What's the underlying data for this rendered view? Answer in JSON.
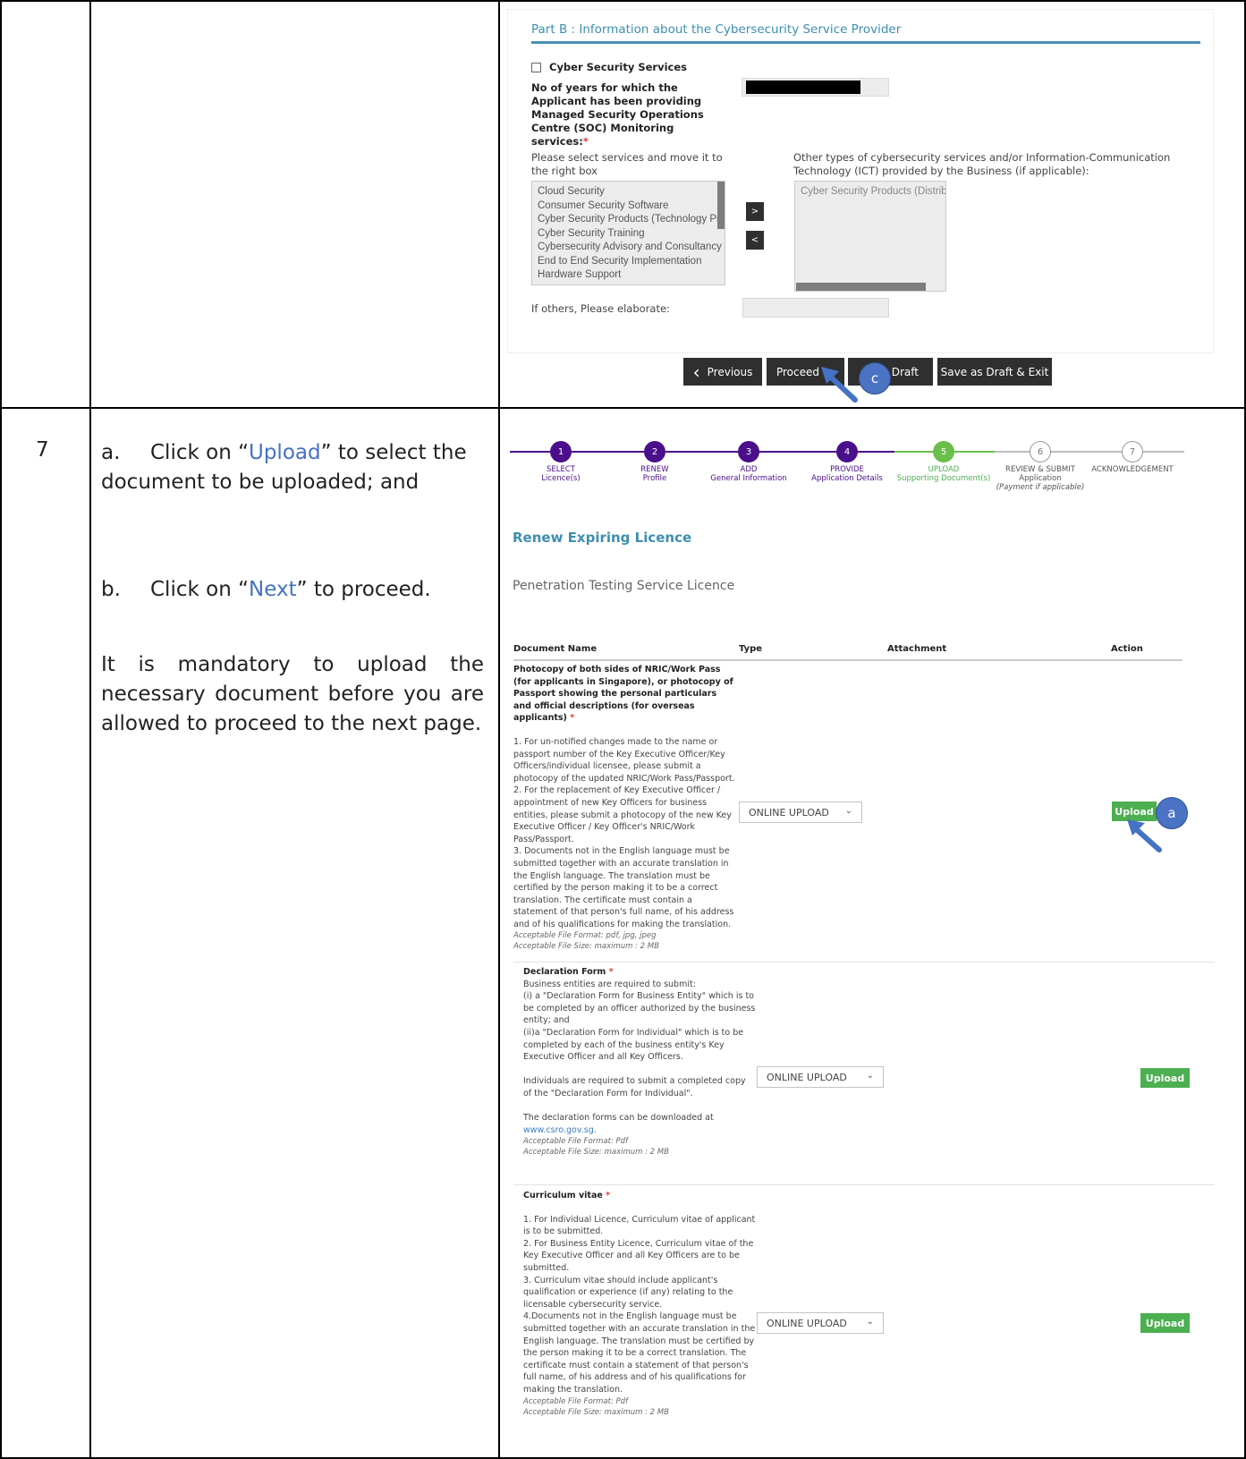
{
  "row7": {
    "number": "7",
    "instr_a_prefix": "a.",
    "instr_a_pre": "Click on “",
    "instr_a_link": "Upload",
    "instr_a_post": "” to select the document to be uploaded; and",
    "instr_b_prefix": "b.",
    "instr_b_pre": "Click on “",
    "instr_b_link": "Next",
    "instr_b_post": "” to proceed.",
    "instr_note": "It is mandatory to upload the necessary document before you are allowed to proceed to the next page."
  },
  "partb": {
    "title": "Part B : Information about the Cybersecurity Service Provider",
    "checkbox_label": "Cyber Security Services",
    "years_label": "No of years for which the Applicant has been providing Managed Security Operations Centre (SOC) Monitoring services:",
    "req_star": "*",
    "select_hint": "Please select services and move it to the right box",
    "other_types": "Other types of cybersecurity services and/or Information-Communication Technology (ICT) provided by the Business (if applicable):",
    "left_options": [
      "Cloud Security",
      "Consumer Security Software",
      "Cyber Security Products (Technology Pro",
      "Cyber Security Training",
      "Cybersecurity Advisory and Consultancy",
      "End to End Security Implementation",
      "Hardware Support"
    ],
    "right_options": [
      "Cyber Security Products (Distribu"
    ],
    "move_right": ">",
    "move_left": "<",
    "elaborate_label": "If others, Please elaborate:",
    "buttons": {
      "previous": "Previous",
      "proceed": "Proceed",
      "draft": "Draft",
      "save_exit": "Save as Draft & Exit"
    },
    "badge_c": "c"
  },
  "stepper": [
    {
      "num": "1",
      "line1": "SELECT",
      "line2": "Licence(s)",
      "line3": "",
      "state": "done"
    },
    {
      "num": "2",
      "line1": "RENEW",
      "line2": "Profile",
      "line3": "",
      "state": "done"
    },
    {
      "num": "3",
      "line1": "ADD",
      "line2": "General Information",
      "line3": "",
      "state": "done"
    },
    {
      "num": "4",
      "line1": "PROVIDE",
      "line2": "Application Details",
      "line3": "",
      "state": "done"
    },
    {
      "num": "5",
      "line1": "UPLOAD",
      "line2": "Supporting Document(s)",
      "line3": "",
      "state": "current"
    },
    {
      "num": "6",
      "line1": "REVIEW & SUBMIT",
      "line2": "Application",
      "line3": "(Payment if applicable)",
      "state": "todo"
    },
    {
      "num": "7",
      "line1": "ACKNOWLEDGEMENT",
      "line2": "",
      "line3": "",
      "state": "todo"
    }
  ],
  "upload_page": {
    "heading": "Renew Expiring Licence",
    "licence": "Penetration Testing Service Licence",
    "columns": {
      "name": "Document Name",
      "type": "Type",
      "attachment": "Attachment",
      "action": "Action"
    },
    "select_value": "ONLINE UPLOAD",
    "upload_label": "Upload",
    "badge_a": "a",
    "doc1": {
      "title": "Photocopy of both sides of NRIC/Work Pass (for applicants in Singapore), or photocopy of Passport showing the personal particulars and official descriptions (for overseas applicants)",
      "body": "1. For un-notified changes made to the name or passport number of the Key Executive Officer/Key Officers/individual licensee, please submit a photocopy of the updated NRIC/Work Pass/Passport.\n2. For the replacement of Key Executive Officer / appointment of new Key Officers for business entities, please submit a photocopy of the new Key Executive Officer / Key Officer's NRIC/Work Pass/Passport.\n3. Documents not in the English language must be submitted together with an accurate translation in the English language. The translation must be certified by the person making it to be a correct translation. The certificate must contain a statement of that person's full name, of his address and of his qualifications for making the translation.",
      "format": "Acceptable File Format: pdf, jpg, jpeg",
      "size": "Acceptable File Size: maximum : 2 MB"
    },
    "doc2": {
      "title": "Declaration Form",
      "body": "Business entities are required to submit:\n(i) a \"Declaration Form for Business Entity\" which is to be completed by an officer authorized by the business entity; and\n(ii)a \"Declaration Form for Individual\" which is to be completed by each of the business entity's Key Executive Officer and all Key Officers.\n\nIndividuals are required to submit a completed copy of the \"Declaration Form for Individual\".\n\nThe declaration forms can be downloaded at",
      "link": "www.csro.gov.sg.",
      "format": "Acceptable File Format: Pdf",
      "size": "Acceptable File Size: maximum : 2 MB"
    },
    "doc3": {
      "title": "Curriculum vitae",
      "body": "1. For Individual Licence, Curriculum vitae of applicant is to be submitted.\n2. For Business Entity Licence, Curriculum vitae of the Key Executive Officer and all Key Officers are to be submitted.\n3. Curriculum vitae should include applicant's qualification or experience (if any) relating to the licensable cybersecurity service.\n4.Documents not in the English language must be submitted together with an accurate translation in the English language. The translation must be certified by the person making it to be a correct translation. The certificate must contain a statement of that person's full name, of his address and of his qualifications for making the translation.",
      "format": "Acceptable File Format: Pdf",
      "size": "Acceptable File Size: maximum : 2 MB"
    }
  },
  "colors": {
    "step_done": "#4b0f8c",
    "step_current": "#6abf4b",
    "upload": "#4caf50",
    "title_blue": "#3d8fb0",
    "badge": "#4b73c4"
  }
}
